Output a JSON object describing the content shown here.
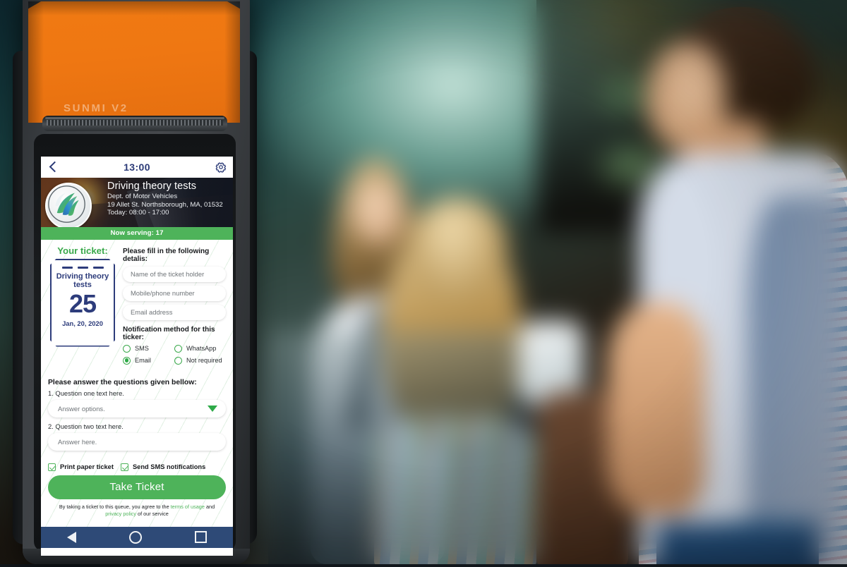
{
  "device": {
    "brand_label": "SUNMI V2",
    "chassis_color": "#3a3e42",
    "printer_color": "#ef7712"
  },
  "app": {
    "statusbar": {
      "back_icon": "chevron-left-icon",
      "clock": "13:00",
      "settings_icon": "gear-icon"
    },
    "venue": {
      "title": "Driving theory tests",
      "department": "Dept. of Motor Vehicles",
      "address": "19 Allet St. Northsborough, MA, 01532",
      "hours": "Today: 08:00 - 17:00",
      "logo_icon": "globe-swirl-logo"
    },
    "now_serving": "Now serving: 17",
    "ticket": {
      "heading": "Your ticket:",
      "service": "Driving theory tests",
      "number": "25",
      "date": "Jan, 20, 2020"
    },
    "details": {
      "heading": "Please fill in the following detalis:",
      "fields": [
        {
          "name": "holder-name",
          "value": "",
          "placeholder": "Name of the ticket holder"
        },
        {
          "name": "phone",
          "value": "",
          "placeholder": "Mobile/phone number"
        },
        {
          "name": "email",
          "value": "",
          "placeholder": "Email address"
        }
      ]
    },
    "notification": {
      "heading": "Notification method for this ticker:",
      "options": [
        {
          "label": "SMS",
          "selected": false
        },
        {
          "label": "WhatsApp",
          "selected": false
        },
        {
          "label": "Email",
          "selected": true
        },
        {
          "label": "Not required",
          "selected": false
        }
      ]
    },
    "questions": {
      "heading": "Please answer the questions given bellow:",
      "q1_label": "1. Question one text here.",
      "q1_placeholder": "Answer options.",
      "q1_dropdown_icon": "caret-down-icon",
      "q2_label": "2. Question two text here.",
      "q2_placeholder": "Answer  here."
    },
    "checkboxes": [
      {
        "label": "Print paper ticket",
        "checked": true
      },
      {
        "label": "Send SMS notifications",
        "checked": true
      }
    ],
    "cta_label": "Take Ticket",
    "terms": {
      "pre": "By taking a ticket to this queue, you agree to the ",
      "link1": "terms of usage",
      "mid": " and ",
      "link2": "privacy policy",
      "post": " of our service"
    },
    "navbar": {
      "back_icon": "triangle-back-icon",
      "home_icon": "circle-home-icon",
      "recents_icon": "square-recents-icon"
    },
    "colors": {
      "green": "#4eb35a",
      "navy": "#2d3c7b",
      "navbar": "#2e4a77"
    }
  }
}
